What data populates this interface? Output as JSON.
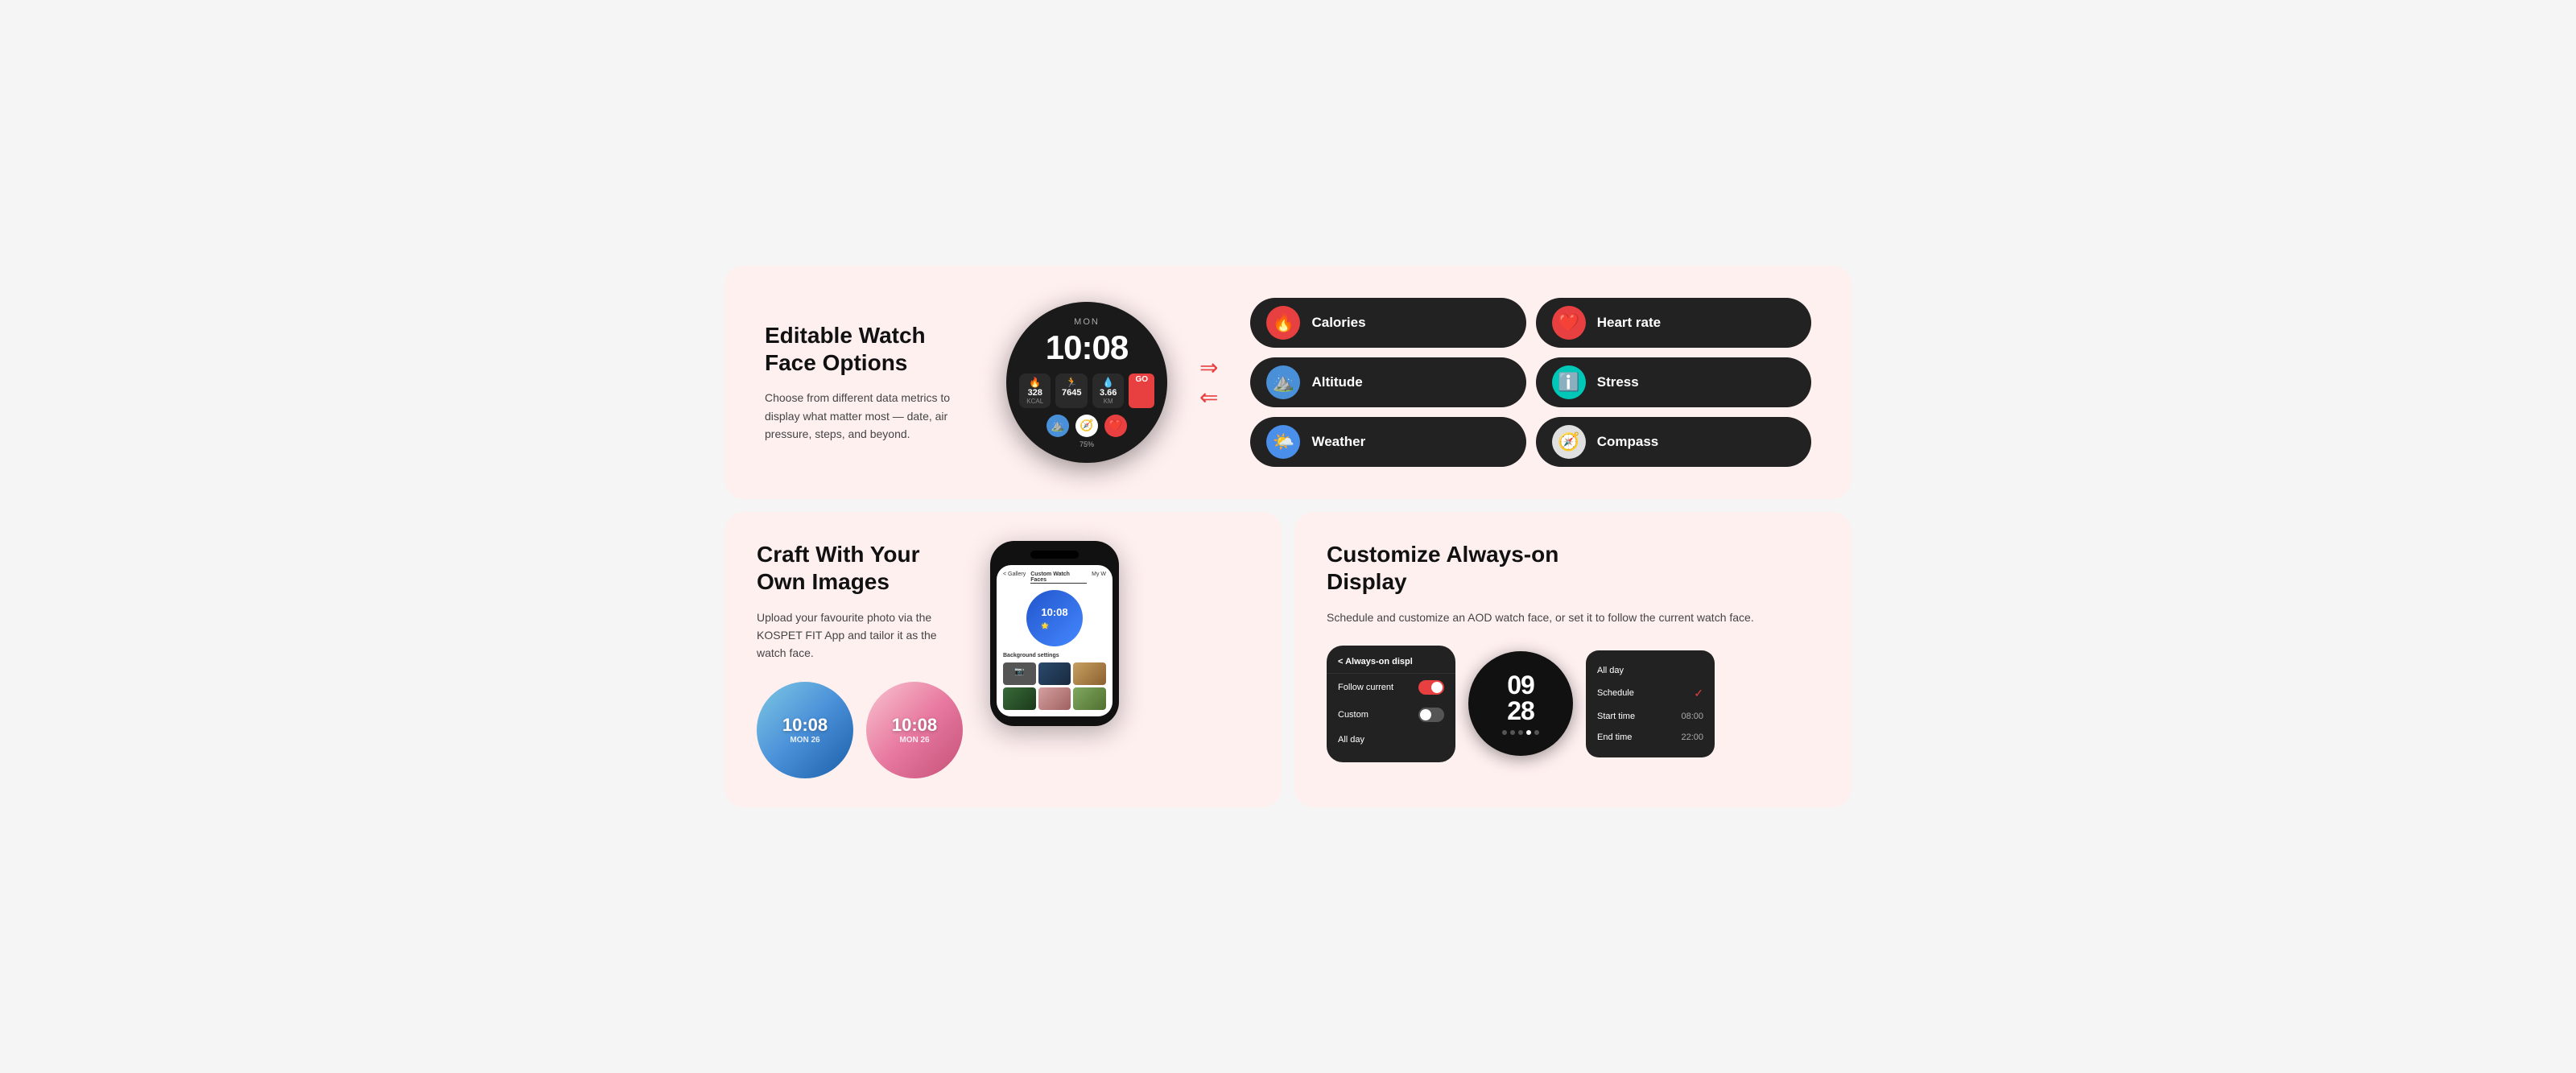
{
  "top": {
    "title": "Editable Watch\nFace Options",
    "desc": "Choose from different data metrics to display what matter most — date, air pressure, steps, and beyond.",
    "watch": {
      "day": "MON",
      "time": "10:08",
      "metric1_val": "328",
      "metric1_lbl": "KCAL",
      "metric2_val": "7645",
      "metric3_val": "3.66",
      "metric3_lbl": "KM",
      "battery": "75%"
    },
    "pills": [
      {
        "id": "calories",
        "label": "Calories",
        "icon": "🔥",
        "bg": "#e84040"
      },
      {
        "id": "heart-rate",
        "label": "Heart rate",
        "icon": "❤️",
        "bg": "#e84040"
      },
      {
        "id": "altitude",
        "label": "Altitude",
        "icon": "⛰️",
        "bg": "#4a90d9"
      },
      {
        "id": "stress",
        "label": "Stress",
        "icon": "ℹ️",
        "bg": "#00c8b8"
      },
      {
        "id": "weather",
        "label": "Weather",
        "icon": "🌤️",
        "bg": "#4a8fea"
      },
      {
        "id": "compass",
        "label": "Compass",
        "icon": "🧭",
        "bg": "#e0e0e0"
      }
    ]
  },
  "craft": {
    "title": "Craft With Your\nOwn Images",
    "desc": "Upload your favourite photo via the KOSPET FIT App and tailor it as the watch face.",
    "watch1_time": "10:08",
    "watch1_date": "MON 26",
    "watch2_time": "10:08",
    "watch2_date": "MON 26",
    "phone": {
      "nav_gallery": "< Gallery",
      "nav_custom": "Custom Watch Faces",
      "nav_my": "My W",
      "bg_label": "Background settings"
    }
  },
  "customize": {
    "title": "Customize Always-on\nDisplay",
    "desc": "Schedule and customize an AOD watch face, or set it to follow the current watch face.",
    "aod_title": "< Always-on displ",
    "follow_label": "Follow current",
    "custom_label": "Custom",
    "allday_label": "All day",
    "watch_time_top": "09",
    "watch_time_bottom": "28",
    "schedule": {
      "allday": "All day",
      "schedule": "Schedule",
      "start_time": "Start time",
      "start_val": "08:00",
      "end_time": "End time",
      "end_val": "22:00"
    }
  }
}
